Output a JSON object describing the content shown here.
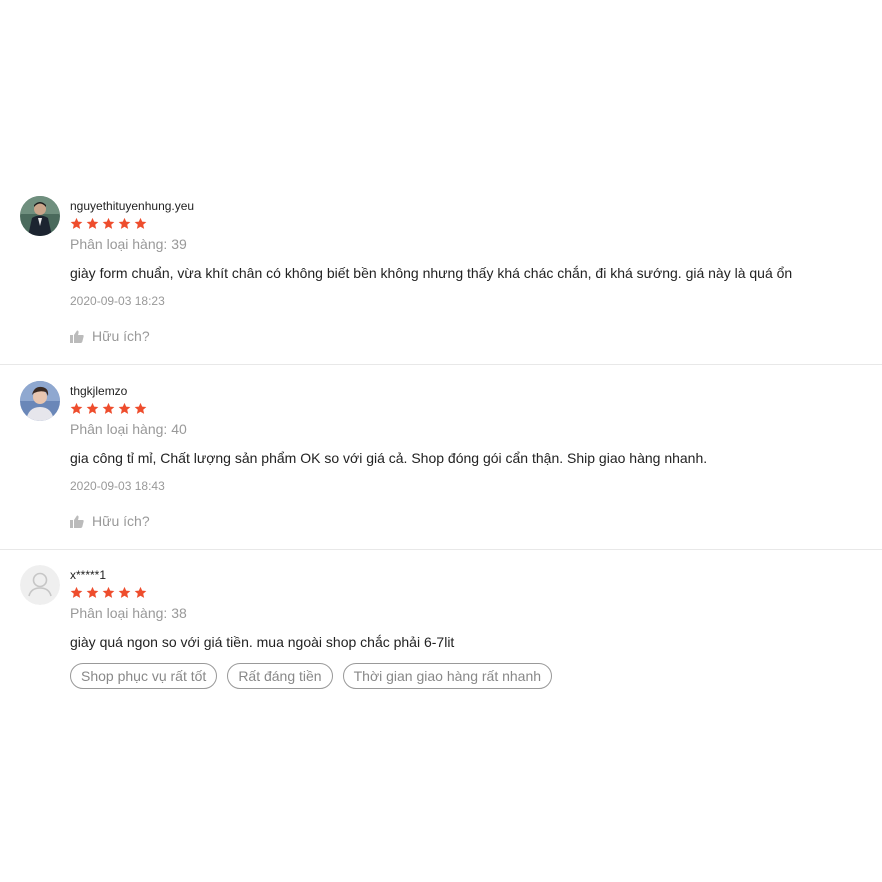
{
  "reviews": [
    {
      "author": "nguyethituyenhung.yeu",
      "rating": 5,
      "variant": "Phân loại hàng: 39",
      "comment": "giày form chuẩn, vừa khít chân có không biết bền không nhưng thấy khá chác chắn, đi khá sướng. giá này là quá ổn",
      "time": "2020-09-03 18:23",
      "helpful_label": "Hữu ích?",
      "avatar_icon": "user-photo-suit"
    },
    {
      "author": "thgkjlemzo",
      "rating": 5,
      "variant": "Phân loại hàng: 40",
      "comment": "gia công tỉ mỉ, Chất lượng sản phẩm OK so với giá cả. Shop đóng gói cẩn thận. Ship giao hàng nhanh.",
      "time": "2020-09-03 18:43",
      "helpful_label": "Hữu ích?",
      "avatar_icon": "user-photo-portrait"
    },
    {
      "author": "x*****1",
      "rating": 5,
      "variant": "Phân loại hàng: 38",
      "comment": "giày quá ngon so với giá tiền. mua ngoài shop chắc phải 6-7lit",
      "tags": [
        "Shop phục vụ rất tốt",
        "Rất đáng tiền",
        "Thời gian giao hàng rất nhanh"
      ],
      "avatar_icon": "default-user-icon"
    }
  ],
  "colors": {
    "star": "#ee4d2d",
    "muted_text": "#999999",
    "text": "#222222",
    "divider": "#e8e8e8"
  }
}
